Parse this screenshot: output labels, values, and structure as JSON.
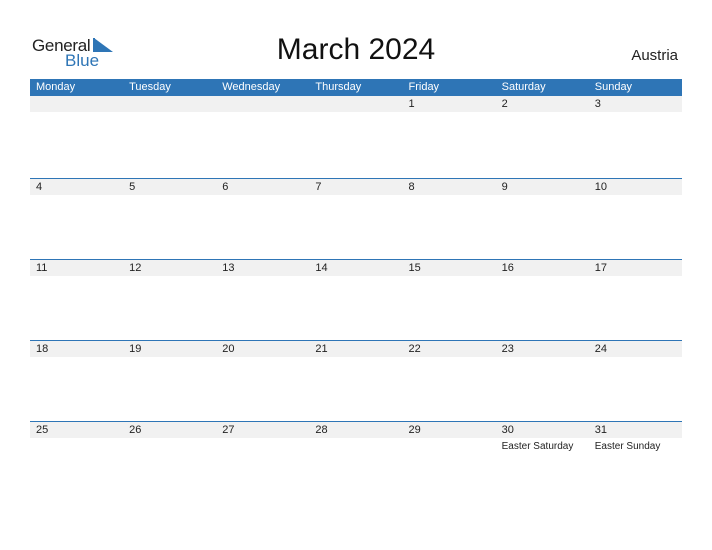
{
  "logo": {
    "word1": "General",
    "word2": "Blue"
  },
  "title": "March 2024",
  "country": "Austria",
  "colors": {
    "accent": "#2E75B6",
    "row_bg": "#F1F1F1"
  },
  "weekdays": [
    "Monday",
    "Tuesday",
    "Wednesday",
    "Thursday",
    "Friday",
    "Saturday",
    "Sunday"
  ],
  "weeks": [
    [
      {
        "day": ""
      },
      {
        "day": ""
      },
      {
        "day": ""
      },
      {
        "day": ""
      },
      {
        "day": "1"
      },
      {
        "day": "2"
      },
      {
        "day": "3"
      }
    ],
    [
      {
        "day": "4"
      },
      {
        "day": "5"
      },
      {
        "day": "6"
      },
      {
        "day": "7"
      },
      {
        "day": "8"
      },
      {
        "day": "9"
      },
      {
        "day": "10"
      }
    ],
    [
      {
        "day": "11"
      },
      {
        "day": "12"
      },
      {
        "day": "13"
      },
      {
        "day": "14"
      },
      {
        "day": "15"
      },
      {
        "day": "16"
      },
      {
        "day": "17"
      }
    ],
    [
      {
        "day": "18"
      },
      {
        "day": "19"
      },
      {
        "day": "20"
      },
      {
        "day": "21"
      },
      {
        "day": "22"
      },
      {
        "day": "23"
      },
      {
        "day": "24"
      }
    ],
    [
      {
        "day": "25"
      },
      {
        "day": "26"
      },
      {
        "day": "27"
      },
      {
        "day": "28"
      },
      {
        "day": "29"
      },
      {
        "day": "30",
        "event": "Easter Saturday"
      },
      {
        "day": "31",
        "event": "Easter Sunday"
      }
    ]
  ]
}
